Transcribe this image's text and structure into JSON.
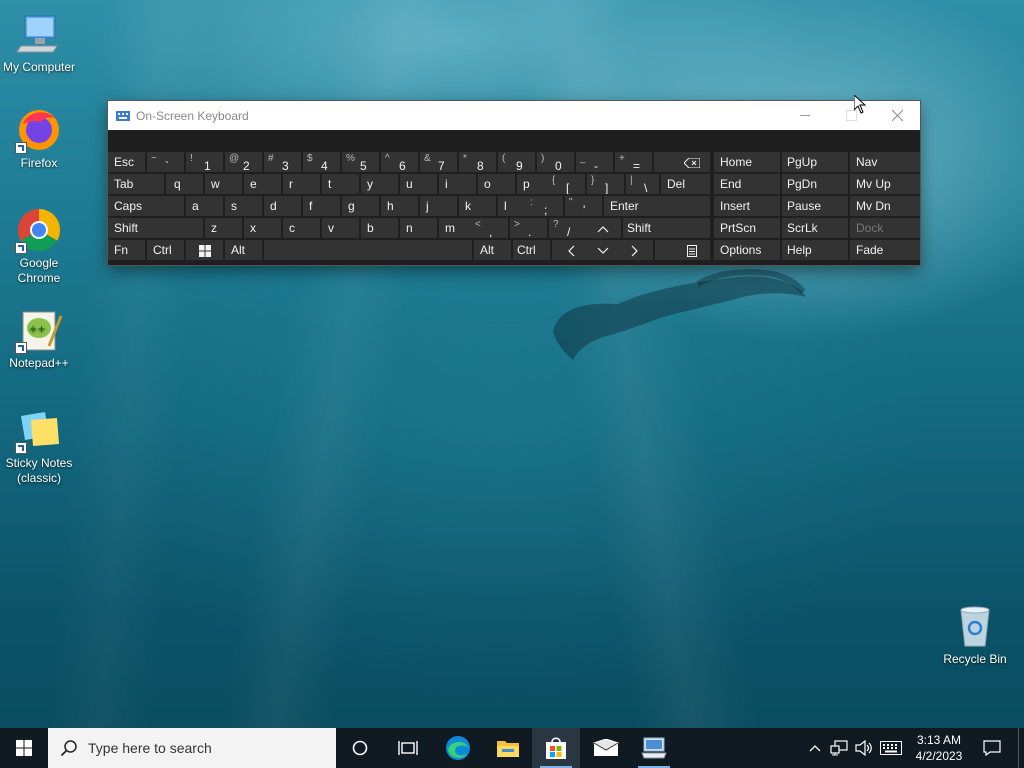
{
  "desktop": {
    "icons": [
      {
        "label": "My Computer"
      },
      {
        "label": "Firefox"
      },
      {
        "label": "Google Chrome"
      },
      {
        "label": "Notepad++"
      },
      {
        "label": "Sticky Notes (classic)"
      },
      {
        "label": "Recycle Bin"
      }
    ]
  },
  "osk": {
    "title": "On-Screen Keyboard",
    "rows": {
      "r1": [
        "Esc",
        "~",
        "`",
        "!",
        "1",
        "@",
        "2",
        "#",
        "3",
        "$",
        "4",
        "%",
        "5",
        "^",
        "6",
        "&",
        "7",
        "*",
        "8",
        "(",
        "9",
        ")",
        "0",
        "_",
        "-",
        "+",
        "="
      ],
      "r2": [
        "Tab",
        "q",
        "w",
        "e",
        "r",
        "t",
        "y",
        "u",
        "i",
        "o",
        "p",
        "{",
        "[",
        "}",
        "]",
        "|",
        "\\",
        "Del"
      ],
      "r3": [
        "Caps",
        "a",
        "s",
        "d",
        "f",
        "g",
        "h",
        "j",
        "k",
        "l",
        ":",
        ";",
        "\"",
        "'",
        "Enter"
      ],
      "r4": [
        "Shift",
        "z",
        "x",
        "c",
        "v",
        "b",
        "n",
        "m",
        "<",
        ",",
        ">",
        ".",
        "?",
        "/",
        "Shift"
      ],
      "r5": [
        "Fn",
        "Ctrl",
        "Alt",
        "Alt",
        "Ctrl"
      ]
    },
    "nav": {
      "home": "Home",
      "pgup": "PgUp",
      "navk": "Nav",
      "end": "End",
      "pgdn": "PgDn",
      "mvup": "Mv Up",
      "insert": "Insert",
      "pause": "Pause",
      "mvdn": "Mv Dn",
      "prtscn": "PrtScn",
      "scrlk": "ScrLk",
      "dock": "Dock",
      "options": "Options",
      "help": "Help",
      "fade": "Fade"
    }
  },
  "taskbar": {
    "search_placeholder": "Type here to search",
    "time": "3:13 AM",
    "date": "4/2/2023"
  }
}
